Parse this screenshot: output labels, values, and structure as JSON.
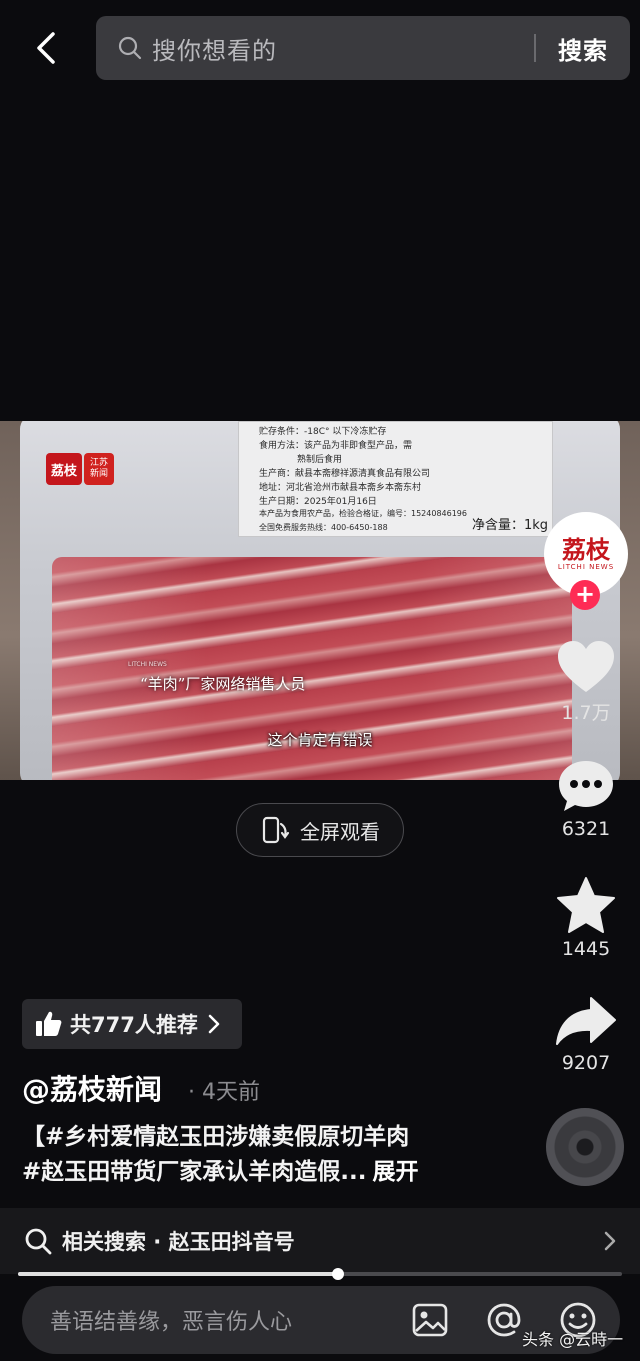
{
  "top": {
    "back_icon": "chevron-left-icon",
    "search_placeholder": "搜你想看的",
    "search_button": "搜索"
  },
  "video": {
    "label_lines": [
      "贮存条件：-18C° 以下冷冻贮存",
      "食用方法：该产品为非即食型产品，需",
      "熟制后食用",
      "生产商：献县本斋穆祥源清真食品有限公司",
      "地址：河北省沧州市献县本斋乡本斋东村",
      "生产日期：2025年01月16日",
      "本产品为食用农产品，检验合格证，编号：15240846196",
      "全国免费服务热线：400-6450-188"
    ],
    "net_weight": "净含量：1kg",
    "watermark_logo": "荔枝",
    "watermark_tag": "江苏\n新闻",
    "subtitle_tag": "LITCHI NEWS",
    "subtitle_name": "“羊肉”厂家网络销售人员",
    "subtitle_caption": "这个肯定有错误"
  },
  "fullscreen": {
    "label": "全屏观看",
    "icon": "rotate-fullscreen-icon"
  },
  "rail": {
    "avatar_text": "荔枝",
    "avatar_sub": "LITCHI NEWS",
    "follow": "+",
    "like_count": "1.7万",
    "comment_count": "6321",
    "favorite_count": "1445",
    "share_count": "9207"
  },
  "recommend": {
    "label": "共777人推荐"
  },
  "author": {
    "name": "@荔枝新闻",
    "time": "· 4天前"
  },
  "caption": {
    "line1": "【#乡村爱情赵玉田涉嫌卖假原切羊肉",
    "line2": "#赵玉田带货厂家承认羊肉造假...",
    "expand": "展开"
  },
  "related": {
    "label": "相关搜索 · 赵玉田抖音号"
  },
  "progress": {
    "value": 0.53
  },
  "comment": {
    "placeholder": "善语结善缘，恶言伤人心",
    "icons": [
      "image-icon",
      "at-icon",
      "emoji-icon"
    ]
  },
  "watermark": "头条 @云時一",
  "colors": {
    "accent": "#fe2c55",
    "brand_red": "#c4161c"
  }
}
